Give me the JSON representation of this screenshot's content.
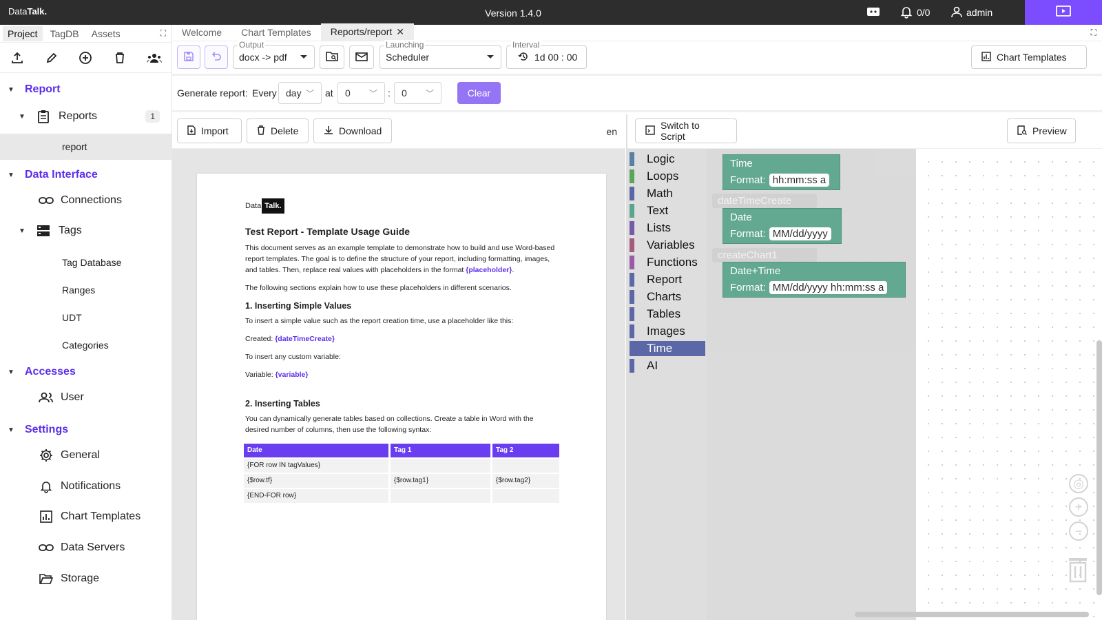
{
  "topbar": {
    "brand_prefix": "Data",
    "brand_bold": "Talk.",
    "version": "Version 1.4.0",
    "alerts": "0/0",
    "user": "admin"
  },
  "sidebar": {
    "tabs": [
      {
        "label": "Project"
      },
      {
        "label": "TagDB"
      },
      {
        "label": "Assets"
      }
    ],
    "sections": {
      "report": "Report",
      "reports": "Reports",
      "reports_count": "1",
      "report_item": "report",
      "data_interface": "Data Interface",
      "connections": "Connections",
      "tags": "Tags",
      "tag_database": "Tag Database",
      "ranges": "Ranges",
      "udt": "UDT",
      "categories": "Categories",
      "accesses": "Accesses",
      "user": "User",
      "settings": "Settings",
      "general": "General",
      "notifications": "Notifications",
      "chart_templates": "Chart Templates",
      "data_servers": "Data Servers",
      "storage": "Storage"
    }
  },
  "tabs": [
    {
      "label": "Welcome"
    },
    {
      "label": "Chart Templates"
    },
    {
      "label": "Reports/report"
    }
  ],
  "toolbar": {
    "output_label": "Output",
    "output_value": "docx -> pdf",
    "launching_label": "Launching",
    "launching_value": "Scheduler",
    "interval_label": "Interval",
    "interval_value": "1d 00 : 00",
    "chart_templates_btn": "Chart Templates"
  },
  "generate": {
    "label": "Generate report:",
    "every": "Every",
    "period": "day",
    "at": "at",
    "hour": "0",
    "colon": ":",
    "minute": "0",
    "clear": "Clear"
  },
  "doc_toolbar": {
    "import": "Import",
    "delete": "Delete",
    "download": "Download",
    "lang": "en"
  },
  "document": {
    "logo_prefix": "Data",
    "logo_box": "Talk.",
    "title": "Test Report - Template Usage Guide",
    "p1": "This document serves as an example template to demonstrate how to build and use Word-based report templates. The goal is to define the structure of your report, including formatting, images, and tables. Then, replace real values with placeholders in the format ",
    "p1_ph": "{placeholder}",
    "p1_end": ".",
    "p2": "The following sections explain how to use these placeholders in different scenarios.",
    "h_simple": "1. Inserting Simple Values",
    "p3": "To insert a simple value such as the report creation time, use a placeholder like this:",
    "created_label": "Created: ",
    "created_ph": "{dateTimeCreate}",
    "p4": "To insert any custom variable:",
    "variable_label": "Variable: ",
    "variable_ph": "{variable}",
    "h_tables": "2. Inserting Tables",
    "p5": "You can dynamically generate tables based on collections. Create a table in Word with the desired number of columns, then use the following syntax:",
    "table_headers": [
      "Date",
      "Tag 1",
      "Tag 2"
    ],
    "table_rows": [
      [
        "{FOR row IN tagValues}",
        "",
        ""
      ],
      [
        "{$row.tf}",
        "{$row.tag1}",
        "{$row.tag2}"
      ],
      [
        "{END-FOR row}",
        "",
        ""
      ]
    ]
  },
  "script_toolbar": {
    "switch": "Switch to Script",
    "preview": "Preview"
  },
  "blockly": {
    "categories": [
      {
        "label": "Logic",
        "color": "#5b80a5"
      },
      {
        "label": "Loops",
        "color": "#5ba55b"
      },
      {
        "label": "Math",
        "color": "#5b67a5"
      },
      {
        "label": "Text",
        "color": "#5ba58c"
      },
      {
        "label": "Lists",
        "color": "#745ba5"
      },
      {
        "label": "Variables",
        "color": "#a55b80"
      },
      {
        "label": "Functions",
        "color": "#995ba5"
      },
      {
        "label": "Report",
        "color": "#5b67a6"
      },
      {
        "label": "Charts",
        "color": "#5b67a6"
      },
      {
        "label": "Tables",
        "color": "#5b67a6"
      },
      {
        "label": "Images",
        "color": "#5b67a6"
      },
      {
        "label": "Time",
        "color": "#5b67a6"
      },
      {
        "label": "AI",
        "color": "#5b67a6"
      }
    ],
    "selected_category": "Time",
    "ghost_1": "dateTimeCreate",
    "ghost_2": "createChart1",
    "blocks": [
      {
        "title": "Time",
        "format_label": "Format:",
        "format": "hh:mm:ss a"
      },
      {
        "title": "Date",
        "format_label": "Format:",
        "format": "MM/dd/yyyy"
      },
      {
        "title": "Date+Time",
        "format_label": "Format:",
        "format": "MM/dd/yyyy hh:mm:ss a"
      }
    ]
  }
}
